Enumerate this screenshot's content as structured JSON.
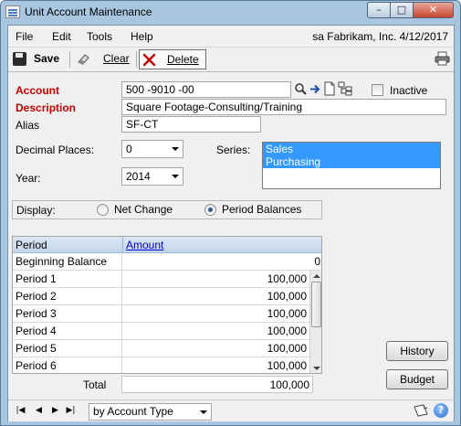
{
  "window": {
    "title": "Unit Account Maintenance",
    "min_glyph": "–",
    "max_glyph": "□",
    "close_glyph": "✕"
  },
  "menu": {
    "items": [
      "File",
      "Edit",
      "Tools",
      "Help"
    ],
    "company_info": "sa  Fabrikam, Inc.  4/12/2017"
  },
  "toolbar": {
    "save_label": "Save",
    "clear_label": "Clear",
    "delete_label": "Delete"
  },
  "form": {
    "account_label": "Account",
    "account_value": "500 -9010 -00",
    "inactive_label": "Inactive",
    "inactive_checked": false,
    "description_label": "Description",
    "description_value": "Square Footage-Consulting/Training",
    "alias_label": "Alias",
    "alias_value": "SF-CT",
    "decimal_label": "Decimal Places:",
    "decimal_value": "0",
    "year_label": "Year:",
    "year_value": "2014",
    "series_label": "Series:",
    "series_options": [
      "Sales",
      "Purchasing"
    ],
    "display_label": "Display:",
    "display_options": [
      "Net Change",
      "Period Balances"
    ],
    "display_selected": "Period Balances"
  },
  "grid": {
    "headers": [
      "Period",
      "Amount"
    ],
    "rows": [
      {
        "period": "Beginning Balance",
        "amount": "0"
      },
      {
        "period": "Period 1",
        "amount": "100,000"
      },
      {
        "period": "Period 2",
        "amount": "100,000"
      },
      {
        "period": "Period 3",
        "amount": "100,000"
      },
      {
        "period": "Period 4",
        "amount": "100,000"
      },
      {
        "period": "Period 5",
        "amount": "100,000"
      },
      {
        "period": "Period 6",
        "amount": "100,000"
      }
    ],
    "total_label": "Total",
    "total_value": "100,000"
  },
  "buttons": {
    "history": "History",
    "budget": "Budget"
  },
  "statusbar": {
    "sort_value": "by Account Type",
    "help_glyph": "?",
    "first_glyph": "|◀",
    "prev_glyph": "◀",
    "next_glyph": "▶",
    "last_glyph": "▶|"
  },
  "colors": {
    "required_label": "#c00000",
    "selection": "#3399ff",
    "link": "#0000cc"
  }
}
